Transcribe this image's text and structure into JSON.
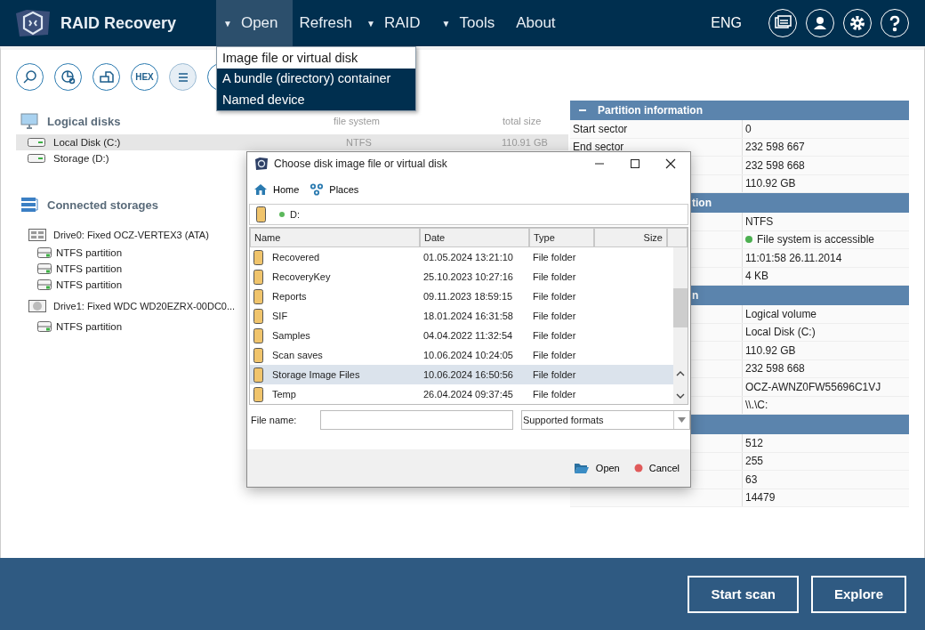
{
  "app": {
    "title": "RAID Recovery"
  },
  "menu": [
    {
      "label": "Open",
      "arrow": "▼",
      "selected": true
    },
    {
      "label": "Refresh",
      "selected": false
    },
    {
      "label": "RAID",
      "arrow": "▼",
      "selected": false
    },
    {
      "label": "Tools",
      "arrow": "▼",
      "selected": false
    },
    {
      "label": "About",
      "selected": false
    }
  ],
  "language": "ENG",
  "header_icons": [
    {
      "kind": "cards"
    },
    {
      "kind": "user"
    },
    {
      "kind": "settings"
    },
    {
      "kind": "help"
    }
  ],
  "open_menu": [
    {
      "label": "Image file or virtual disk",
      "selected": true
    },
    {
      "label": "A bundle (directory) container",
      "selected": false
    },
    {
      "label": "Named device",
      "selected": false
    }
  ],
  "toolbar": [
    {
      "kind": "search"
    },
    {
      "kind": "chart"
    },
    {
      "kind": "disks"
    },
    {
      "kind": "hex",
      "label": "HEX"
    },
    {
      "kind": "list"
    },
    {
      "kind": "plain"
    }
  ],
  "logical_disks": {
    "title": "Logical disks",
    "columns": [
      "file system",
      "total size"
    ],
    "rows": [
      {
        "name": "Local Disk (C:)",
        "file_system": "NTFS",
        "size": "110.91 GB",
        "selected": true
      },
      {
        "name": "Storage (D:)",
        "selected": false
      }
    ]
  },
  "connected_storages": {
    "title": "Connected storages",
    "drives": [
      {
        "name": "Drive0: Fixed OCZ-VERTEX3 (ATA)",
        "kind": "ssd",
        "children": [
          {
            "name": "NTFS partition"
          },
          {
            "name": "NTFS partition"
          },
          {
            "name": "NTFS partition"
          }
        ]
      },
      {
        "name": "Drive1: Fixed WDC WD20EZRX-00DC0...",
        "kind": "hdd",
        "children": [
          {
            "name": "NTFS partition"
          }
        ]
      }
    ]
  },
  "info_panel": [
    {
      "title": "Partition information",
      "clipped": false,
      "rows": [
        {
          "label": "Start sector",
          "value": "0"
        },
        {
          "label": "End sector",
          "value": "232 598 667"
        },
        {
          "value": "232 598 668"
        },
        {
          "value": "110.92 GB"
        }
      ]
    },
    {
      "title": "tion",
      "clipped": true,
      "rows": [
        {
          "value": "NTFS"
        },
        {
          "value": "File system is accessible",
          "color": "#4caf50"
        },
        {
          "value": "11:01:58 26.11.2014"
        },
        {
          "value": "4 KB"
        }
      ]
    },
    {
      "title": "n",
      "clipped": true,
      "rows": [
        {
          "value": "Logical volume"
        },
        {
          "value": "Local Disk (C:)"
        },
        {
          "value": "110.92 GB"
        },
        {
          "value": "232 598 668"
        },
        {
          "value": "OCZ-AWNZ0FW55696C1VJ"
        },
        {
          "value": "\\\\.\\C:"
        }
      ]
    },
    {
      "rows": [
        {
          "value": "512"
        },
        {
          "value": "255"
        },
        {
          "value": "63"
        },
        {
          "value": "14479"
        }
      ]
    }
  ],
  "dialog": {
    "title": "Choose disk image file or virtual disk",
    "nav": [
      {
        "label": "Home",
        "kind": "home"
      },
      {
        "label": "Places",
        "kind": "places"
      }
    ],
    "path": "D:",
    "columns": [
      "Name",
      "Date",
      "Type",
      "Size"
    ],
    "rows": [
      {
        "name": "Recovered",
        "date": "01.05.2024 13:21:10",
        "type": "File folder",
        "selected": false
      },
      {
        "name": "RecoveryKey",
        "date": "25.10.2023 10:27:16",
        "type": "File folder",
        "selected": false
      },
      {
        "name": "Reports",
        "date": "09.11.2023 18:59:15",
        "type": "File folder",
        "selected": false
      },
      {
        "name": "SIF",
        "date": "18.01.2024 16:31:58",
        "type": "File folder",
        "selected": false
      },
      {
        "name": "Samples",
        "date": "04.04.2022 11:32:54",
        "type": "File folder",
        "selected": false
      },
      {
        "name": "Scan saves",
        "date": "10.06.2024 10:24:05",
        "type": "File folder",
        "selected": false
      },
      {
        "name": "Storage Image Files",
        "date": "10.06.2024 16:50:56",
        "type": "File folder",
        "selected": true
      },
      {
        "name": "Temp",
        "date": "26.04.2024 09:37:45",
        "type": "File folder",
        "selected": false
      }
    ],
    "file_name_label": "File name:",
    "filter": "Supported formats",
    "buttons": [
      {
        "label": "Open",
        "kind": "open"
      },
      {
        "label": "Cancel",
        "kind": "cancel"
      }
    ]
  },
  "actions": [
    {
      "label": "Start scan"
    },
    {
      "label": "Explore"
    }
  ]
}
